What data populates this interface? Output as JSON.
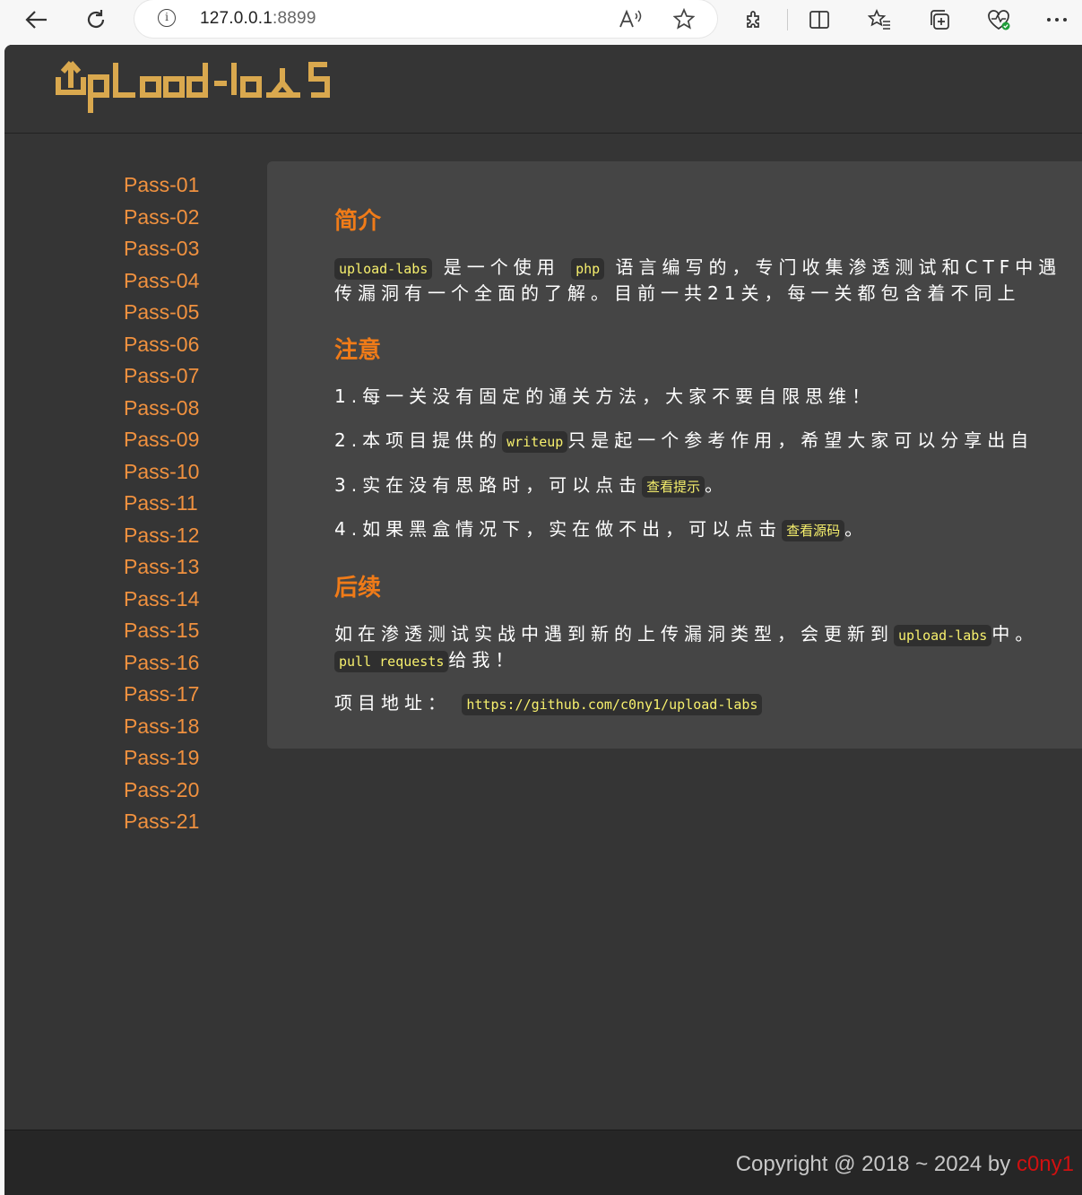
{
  "browser": {
    "url_host": "127.0.0.1",
    "url_port": ":8899"
  },
  "site": {
    "logo_text": "Upload-labs"
  },
  "sidebar": {
    "items": [
      "Pass-01",
      "Pass-02",
      "Pass-03",
      "Pass-04",
      "Pass-05",
      "Pass-06",
      "Pass-07",
      "Pass-08",
      "Pass-09",
      "Pass-10",
      "Pass-11",
      "Pass-12",
      "Pass-13",
      "Pass-14",
      "Pass-15",
      "Pass-16",
      "Pass-17",
      "Pass-18",
      "Pass-19",
      "Pass-20",
      "Pass-21"
    ]
  },
  "content": {
    "intro": {
      "heading": "简介",
      "code1": "upload-labs",
      "text1": "是一个使用",
      "code2": "php",
      "text2": "语言编写的，专门收集渗透测试和CTF中遇",
      "line2": "传漏洞有一个全面的了解。目前一共21关，每一关都包含着不同上"
    },
    "notes": {
      "heading": "注意",
      "n1": "1.每一关没有固定的通关方法，大家不要自限思维！",
      "n2_pre": "2.本项目提供的",
      "n2_code": "writeup",
      "n2_post": "只是起一个参考作用，希望大家可以分享出自",
      "n3_pre": "3.实在没有思路时，可以点击",
      "n3_code": "查看提示",
      "n3_post": "。",
      "n4_pre": "4.如果黑盒情况下，实在做不出，可以点击",
      "n4_code": "查看源码",
      "n4_post": "。"
    },
    "followup": {
      "heading": "后续",
      "text1": "如在渗透测试实战中遇到新的上传漏洞类型，会更新到",
      "code1": "upload-labs",
      "text2": "中。",
      "code2": "pull requests",
      "text3": "给我！",
      "addr_label": "项目地址：",
      "addr_url": "https://github.com/c0ny1/upload-labs"
    }
  },
  "footer": {
    "copyright": "Copyright @ 2018 ~ 2024 by ",
    "author": "c0ny1"
  },
  "colors": {
    "accent": "#f07b18",
    "menu": "#f0913f",
    "code": "#f7f06d",
    "logo": "#d9a84e"
  }
}
